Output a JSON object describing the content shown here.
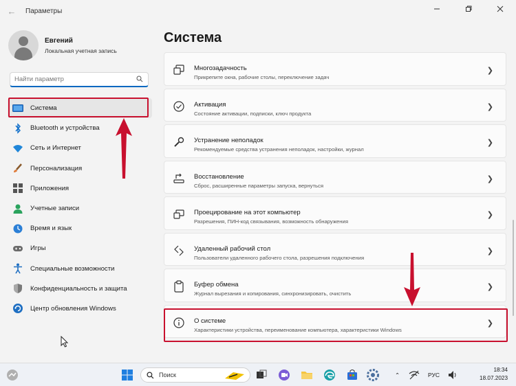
{
  "window": {
    "title": "Параметры",
    "controls": [
      "minimize",
      "restore",
      "close"
    ]
  },
  "profile": {
    "name": "Евгений",
    "account_type": "Локальная учетная запись"
  },
  "search": {
    "placeholder": "Найти параметр"
  },
  "sidebar": {
    "items": [
      {
        "label": "Система",
        "icon": "system-icon",
        "active": true
      },
      {
        "label": "Bluetooth и устройства",
        "icon": "bluetooth-icon"
      },
      {
        "label": "Сеть и Интернет",
        "icon": "wifi-icon"
      },
      {
        "label": "Персонализация",
        "icon": "brush-icon"
      },
      {
        "label": "Приложения",
        "icon": "apps-icon"
      },
      {
        "label": "Учетные записи",
        "icon": "accounts-icon"
      },
      {
        "label": "Время и язык",
        "icon": "time-language-icon"
      },
      {
        "label": "Игры",
        "icon": "gaming-icon"
      },
      {
        "label": "Специальные возможности",
        "icon": "accessibility-icon"
      },
      {
        "label": "Конфиденциальность и защита",
        "icon": "shield-icon"
      },
      {
        "label": "Центр обновления Windows",
        "icon": "windows-update-icon"
      }
    ]
  },
  "main": {
    "title": "Система",
    "cards": [
      {
        "title": "Многозадачность",
        "subtitle": "Прикрепите окна, рабочие столы, переключение задач",
        "icon": "multitasking-icon"
      },
      {
        "title": "Активация",
        "subtitle": "Состояние активации, подписки, ключ продукта",
        "icon": "activation-icon"
      },
      {
        "title": "Устранение неполадок",
        "subtitle": "Рекомендуемые средства устранения неполадок, настройки, журнал",
        "icon": "wrench-icon"
      },
      {
        "title": "Восстановление",
        "subtitle": "Сброс, расширенные параметры запуска, вернуться",
        "icon": "recovery-icon"
      },
      {
        "title": "Проецирование на этот компьютер",
        "subtitle": "Разрешения, ПИН-код связывания, возможность обнаружения",
        "icon": "projection-icon"
      },
      {
        "title": "Удаленный рабочий стол",
        "subtitle": "Пользователи удаленного рабочего стола, разрешения подключения",
        "icon": "remote-desktop-icon"
      },
      {
        "title": "Буфер обмена",
        "subtitle": "Журнал вырезания и копирования, синхронизировать, очистить",
        "icon": "clipboard-icon"
      },
      {
        "title": "О системе",
        "subtitle": "Характеристики устройства, переименование компьютера, характеристики Windows",
        "icon": "info-icon"
      }
    ]
  },
  "annotation_color": "#c8102e",
  "taskbar": {
    "search_label": "Поиск",
    "language": "РУС",
    "time": "18:34",
    "date": "18.07.2023"
  }
}
